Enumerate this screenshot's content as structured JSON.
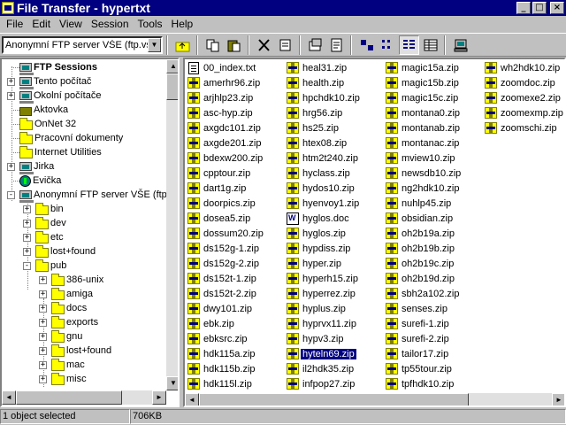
{
  "window": {
    "title": "File Transfer - hypertxt"
  },
  "menu": [
    "File",
    "Edit",
    "View",
    "Session",
    "Tools",
    "Help"
  ],
  "toolbar": {
    "address_value": "Anonymní FTP server VŠE (ftp.vse"
  },
  "tree": {
    "items": [
      {
        "label": "FTP Sessions",
        "icon": "computer-icon"
      },
      {
        "label": "Tento počítač",
        "icon": "computer-icon"
      },
      {
        "label": "Okolní počítače",
        "icon": "network-icon"
      },
      {
        "label": "Aktovka",
        "icon": "briefcase-icon"
      },
      {
        "label": "OnNet 32",
        "icon": "folder-icon"
      },
      {
        "label": "Pracovní dokumenty",
        "icon": "folder-icon"
      },
      {
        "label": "Internet Utilities",
        "icon": "folder-icon"
      },
      {
        "label": "Jirka",
        "icon": "computer-icon"
      },
      {
        "label": "Evička",
        "icon": "globe-icon"
      },
      {
        "label": "Anonymní FTP server VŠE (ftp.",
        "icon": "computer-icon"
      },
      {
        "label": "bin",
        "icon": "folder-icon"
      },
      {
        "label": "dev",
        "icon": "folder-icon"
      },
      {
        "label": "etc",
        "icon": "folder-icon"
      },
      {
        "label": "lost+found",
        "icon": "folder-icon"
      },
      {
        "label": "pub",
        "icon": "folder-icon"
      },
      {
        "label": "386-unix",
        "icon": "folder-icon"
      },
      {
        "label": "amiga",
        "icon": "folder-icon"
      },
      {
        "label": "docs",
        "icon": "folder-icon"
      },
      {
        "label": "exports",
        "icon": "folder-icon"
      },
      {
        "label": "gnu",
        "icon": "folder-icon"
      },
      {
        "label": "lost+found",
        "icon": "folder-icon"
      },
      {
        "label": "mac",
        "icon": "folder-icon"
      },
      {
        "label": "misc",
        "icon": "folder-icon"
      }
    ]
  },
  "files": {
    "columns": [
      [
        "00_index.txt",
        "amerhr96.zip",
        "arjhlp23.zip",
        "asc-hyp.zip",
        "axgdc101.zip",
        "axgde201.zip",
        "bdexw200.zip",
        "cpptour.zip",
        "dart1g.zip",
        "doorpics.zip",
        "dosea5.zip",
        "dossum20.zip",
        "ds152g-1.zip",
        "ds152g-2.zip",
        "ds152t-1.zip",
        "ds152t-2.zip",
        "dwy101.zip",
        "ebk.zip",
        "ebksrc.zip",
        "hdk115a.zip",
        "hdk115b.zip",
        "hdk115l.zip"
      ],
      [
        "heal31.zip",
        "health.zip",
        "hpchdk10.zip",
        "hrg56.zip",
        "hs25.zip",
        "htex08.zip",
        "htm2t240.zip",
        "hyclass.zip",
        "hydos10.zip",
        "hyenvoy1.zip",
        "hyglos.doc",
        "hyglos.zip",
        "hypdiss.zip",
        "hyper.zip",
        "hyperh15.zip",
        "hyperrez.zip",
        "hyplus.zip",
        "hyprvx11.zip",
        "hypv3.zip",
        "hyteln69.zip",
        "il2hdk35.zip",
        "infpop27.zip"
      ],
      [
        "magic15a.zip",
        "magic15b.zip",
        "magic15c.zip",
        "montana0.zip",
        "montanab.zip",
        "montanac.zip",
        "mview10.zip",
        "newsdb10.zip",
        "ng2hdk10.zip",
        "nuhlp45.zip",
        "obsidian.zip",
        "oh2b19a.zip",
        "oh2b19b.zip",
        "oh2b19c.zip",
        "oh2b19d.zip",
        "sbh2a102.zip",
        "senses.zip",
        "surefi-1.zip",
        "surefi-2.zip",
        "tailor17.zip",
        "tp55tour.zip",
        "tpfhdk10.zip"
      ],
      [
        "wh2hdk10.zip",
        "zoomdoc.zip",
        "zoomexe2.zip",
        "zoomexmp.zip",
        "zoomschi.zip"
      ]
    ],
    "selected": "hyteln69.zip"
  },
  "status": {
    "objects": "1 object selected",
    "size": "706KB"
  }
}
